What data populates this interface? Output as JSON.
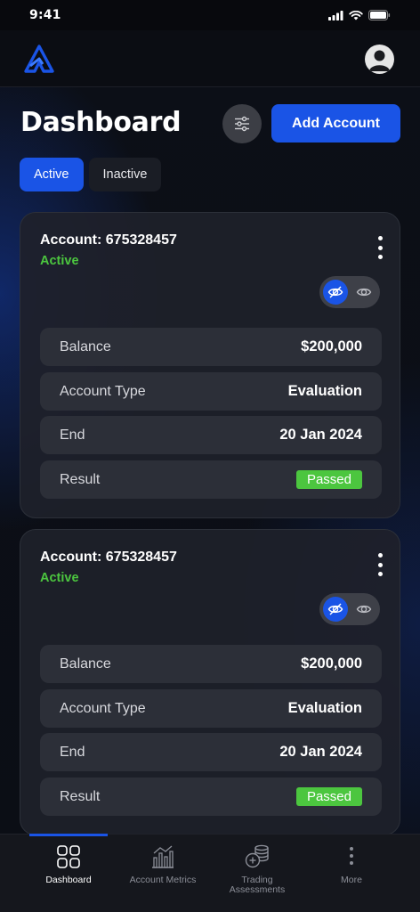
{
  "status_bar": {
    "time": "9:41"
  },
  "header": {
    "title": "Dashboard",
    "add_account_label": "Add Account"
  },
  "tabs": [
    {
      "label": "Active",
      "selected": true
    },
    {
      "label": "Inactive",
      "selected": false
    }
  ],
  "accounts": [
    {
      "title": "Account: 675328457",
      "status": "Active",
      "rows": {
        "balance_label": "Balance",
        "balance_value": "$200,000",
        "type_label": "Account Type",
        "type_value": "Evaluation",
        "end_label": "End",
        "end_value": "20 Jan 2024",
        "result_label": "Result",
        "result_value": "Passed"
      }
    },
    {
      "title": "Account: 675328457",
      "status": "Active",
      "rows": {
        "balance_label": "Balance",
        "balance_value": "$200,000",
        "type_label": "Account Type",
        "type_value": "Evaluation",
        "end_label": "End",
        "end_value": "20 Jan 2024",
        "result_label": "Result",
        "result_value": "Passed"
      }
    }
  ],
  "bottom_nav": {
    "dashboard": "Dashboard",
    "metrics": "Account Metrics",
    "assessments": "Trading Assessments",
    "more": "More"
  },
  "colors": {
    "accent": "#1a54e6",
    "success": "#4cc63f",
    "card": "#1e212a",
    "row": "#2c2f38"
  },
  "icons": [
    "logo-icon",
    "avatar-icon",
    "filter-icon",
    "kebab-icon",
    "eye-off-icon",
    "eye-icon",
    "dashboard-grid-icon",
    "chart-icon",
    "coins-icon",
    "more-icon"
  ]
}
